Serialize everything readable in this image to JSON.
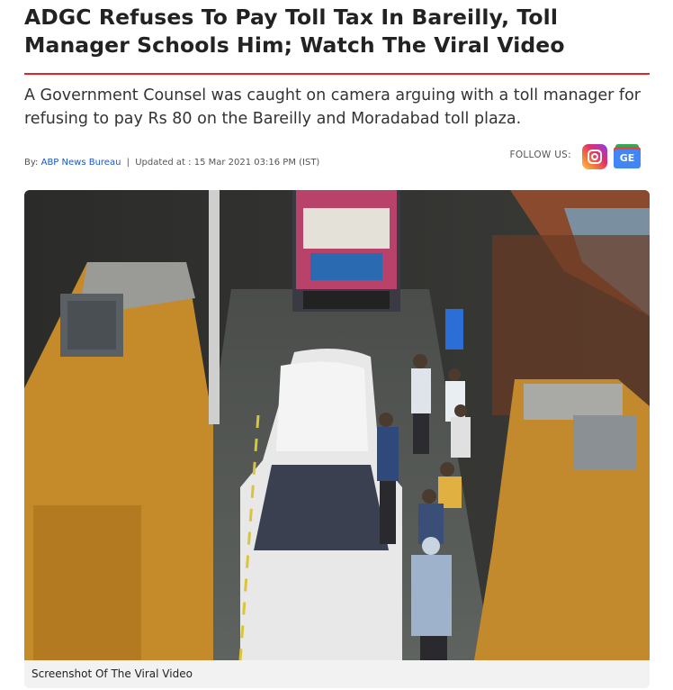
{
  "article": {
    "headline": "ADGC Refuses To Pay Toll Tax In Bareilly, Toll Manager Schools Him; Watch The Viral Video",
    "summary": "A Government Counsel was caught on camera arguing with a toll manager for refusing to pay Rs 80 on the Bareilly and Moradabad toll plaza.",
    "byline": {
      "by_label": "By:",
      "author": "ABP News Bureau",
      "separator": "|",
      "updated_label": "Updated at :",
      "updated_at": "15 Mar 2021 03:16 PM (IST)"
    },
    "follow": {
      "label": "FOLLOW US:",
      "icons": [
        "instagram-icon",
        "google-news-icon"
      ],
      "google_news_text": "GE"
    },
    "figure": {
      "caption": "Screenshot Of The Viral Video"
    }
  },
  "colors": {
    "accent_rule": "#e0242b",
    "author_link": "#1a56c9",
    "headline": "#222222",
    "caption_bg": "#f2f2f2"
  }
}
